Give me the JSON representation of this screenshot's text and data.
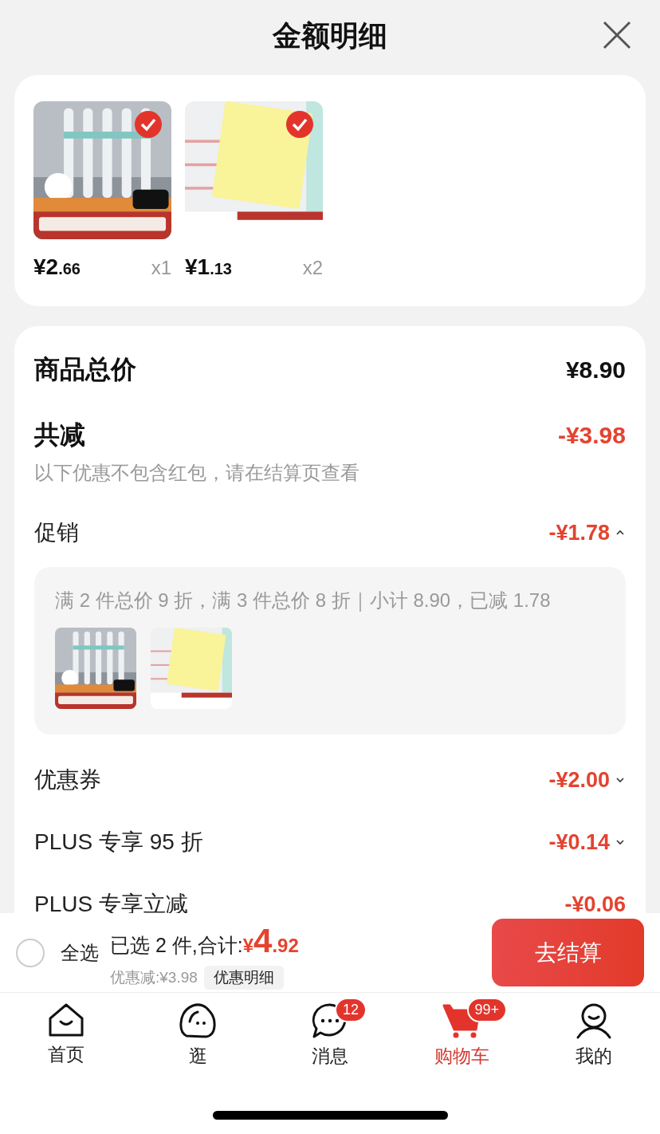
{
  "header": {
    "title": "金额明细"
  },
  "products": [
    {
      "kind": "picture",
      "checked": true,
      "price_main": "¥2",
      "price_cents": ".66",
      "quantity": "x1"
    },
    {
      "kind": "picture",
      "checked": true,
      "price_main": "¥1",
      "price_cents": ".13",
      "quantity": "x2"
    }
  ],
  "summary": {
    "total_label": "商品总价",
    "total_value": "¥8.90",
    "reduce_label": "共减",
    "reduce_value": "-¥3.98",
    "note": "以下优惠不包含红包，请在结算页查看"
  },
  "discounts": [
    {
      "kind": "expandable",
      "label": "促销",
      "amount": "-¥1.78",
      "expanded": true
    },
    {
      "kind": "expandable",
      "label": "优惠券",
      "amount": "-¥2.00",
      "expanded": false
    },
    {
      "kind": "expandable",
      "label": "PLUS 专享 95 折",
      "amount": "-¥0.14",
      "expanded": false
    },
    {
      "kind": "plain",
      "label": "PLUS 专享立减",
      "amount": "-¥0.06"
    }
  ],
  "promo_box": {
    "text": "满 2 件总价 9 折，满 3 件总价 8 折｜小计 8.90，已减 1.78"
  },
  "checkout_bar": {
    "select_all": {
      "label": "全选",
      "checked": false
    },
    "selected_text": "已选 2 件,合计:",
    "total_symbol": "¥",
    "total_main": "4",
    "total_cents": ".92",
    "saved_text": "优惠减:¥3.98",
    "detail_button": "优惠明细",
    "checkout_button": "去结算"
  },
  "tabs": [
    {
      "label": "首页",
      "selected": false
    },
    {
      "label": "逛",
      "selected": false
    },
    {
      "label": "消息",
      "selected": false,
      "badge": "12"
    },
    {
      "label": "购物车",
      "selected": true,
      "badge": "99+"
    },
    {
      "label": "我的",
      "selected": false
    }
  ]
}
